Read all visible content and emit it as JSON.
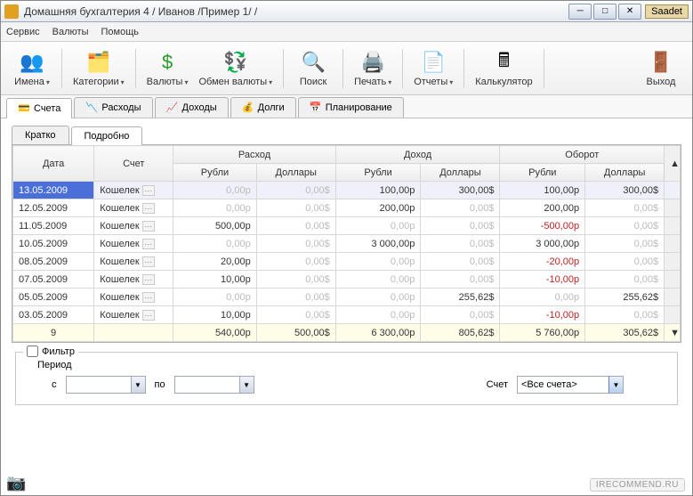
{
  "window": {
    "title": "Домашняя бухгалтерия 4  / Иванов /Пример 1/ /",
    "badge": "Saadet"
  },
  "menu": {
    "service": "Сервис",
    "currencies": "Валюты",
    "help": "Помощь"
  },
  "toolbar": {
    "names": "Имена",
    "categories": "Категории",
    "currencies": "Валюты",
    "exchange": "Обмен валюты",
    "search": "Поиск",
    "print": "Печать",
    "reports": "Отчеты",
    "calc": "Калькулятор",
    "exit": "Выход"
  },
  "tabs": {
    "accounts": "Счета",
    "expenses": "Расходы",
    "income": "Доходы",
    "debts": "Долги",
    "planning": "Планирование"
  },
  "subtabs": {
    "short": "Кратко",
    "detail": "Подробно"
  },
  "headers": {
    "date": "Дата",
    "account": "Счет",
    "expense": "Расход",
    "income": "Доход",
    "turnover": "Оборот",
    "rub": "Рубли",
    "usd": "Доллары"
  },
  "rows": [
    {
      "date": "13.05.2009",
      "acct": "Кошелек",
      "er": "0,00р",
      "eu": "0,00$",
      "ir": "100,00р",
      "iu": "300,00$",
      "tr": "100,00р",
      "tu": "300,00$",
      "sel": true,
      "er_gray": true,
      "eu_gray": true
    },
    {
      "date": "12.05.2009",
      "acct": "Кошелек",
      "er": "0,00р",
      "eu": "0,00$",
      "ir": "200,00р",
      "iu": "0,00$",
      "tr": "200,00р",
      "tu": "0,00$",
      "er_gray": true,
      "eu_gray": true,
      "iu_gray": true,
      "tu_gray": true
    },
    {
      "date": "11.05.2009",
      "acct": "Кошелек",
      "er": "500,00р",
      "eu": "0,00$",
      "ir": "0,00р",
      "iu": "0,00$",
      "tr": "-500,00р",
      "tu": "0,00$",
      "eu_gray": true,
      "ir_gray": true,
      "iu_gray": true,
      "tr_neg": true,
      "tu_gray": true
    },
    {
      "date": "10.05.2009",
      "acct": "Кошелек",
      "er": "0,00р",
      "eu": "0,00$",
      "ir": "3 000,00р",
      "iu": "0,00$",
      "tr": "3 000,00р",
      "tu": "0,00$",
      "er_gray": true,
      "eu_gray": true,
      "iu_gray": true,
      "tu_gray": true
    },
    {
      "date": "08.05.2009",
      "acct": "Кошелек",
      "er": "20,00р",
      "eu": "0,00$",
      "ir": "0,00р",
      "iu": "0,00$",
      "tr": "-20,00р",
      "tu": "0,00$",
      "eu_gray": true,
      "ir_gray": true,
      "iu_gray": true,
      "tr_neg": true,
      "tu_gray": true
    },
    {
      "date": "07.05.2009",
      "acct": "Кошелек",
      "er": "10,00р",
      "eu": "0,00$",
      "ir": "0,00р",
      "iu": "0,00$",
      "tr": "-10,00р",
      "tu": "0,00$",
      "eu_gray": true,
      "ir_gray": true,
      "iu_gray": true,
      "tr_neg": true,
      "tu_gray": true
    },
    {
      "date": "05.05.2009",
      "acct": "Кошелек",
      "er": "0,00р",
      "eu": "0,00$",
      "ir": "0,00р",
      "iu": "255,62$",
      "tr": "0,00р",
      "tu": "255,62$",
      "er_gray": true,
      "eu_gray": true,
      "ir_gray": true,
      "tr_gray": true
    },
    {
      "date": "03.05.2009",
      "acct": "Кошелек",
      "er": "10,00р",
      "eu": "0,00$",
      "ir": "0,00р",
      "iu": "0,00$",
      "tr": "-10,00р",
      "tu": "0,00$",
      "eu_gray": true,
      "ir_gray": true,
      "iu_gray": true,
      "tr_neg": true,
      "tu_gray": true
    }
  ],
  "total": {
    "count": "9",
    "er": "540,00р",
    "eu": "500,00$",
    "ir": "6 300,00р",
    "iu": "805,62$",
    "tr": "5 760,00р",
    "tu": "305,62$"
  },
  "filter": {
    "label": "Фильтр",
    "period": "Период",
    "from": "с",
    "to": "по",
    "account": "Счет",
    "account_value": "<Все счета>"
  },
  "watermark": "IRECOMMEND.RU"
}
